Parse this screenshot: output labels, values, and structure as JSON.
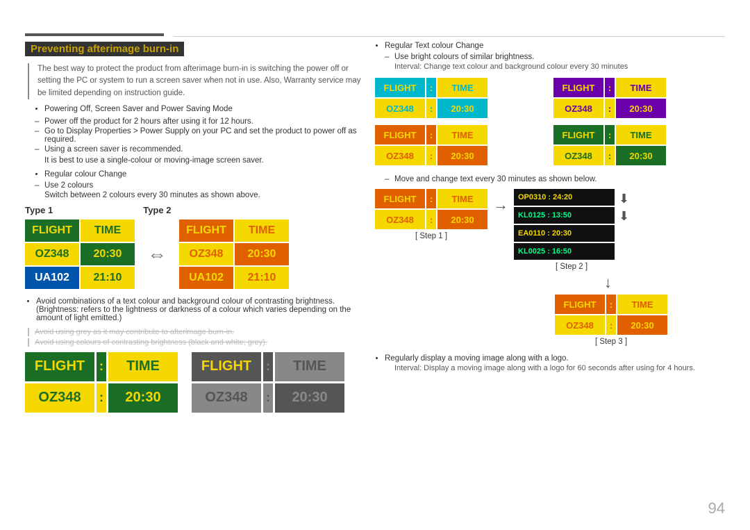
{
  "page": {
    "number": "94",
    "title": "Preventing afterimage burn-in"
  },
  "left": {
    "section_title": "Preventing afterimage burn-in",
    "intro": "The best way to protect the product from afterimage burn-in is switching the power off or setting the PC or system to run a screen saver when not in use. Also, Warranty service may be limited depending on instruction guide.",
    "bullets": [
      "Powering Off, Screen Saver and Power Saving Mode"
    ],
    "sub_bullets_1": [
      "Power off the product for 2 hours after using it for 12 hours.",
      "Go to Display Properties > Power Supply on your PC and set the product to power off as required.",
      "Using a screen saver is recommended."
    ],
    "note_screensaver": "It is best to use a single-colour or moving-image screen saver.",
    "bullets_2": [
      "Regular colour Change"
    ],
    "sub_bullets_2": [
      "Use 2 colours"
    ],
    "switch_note": "Switch between 2 colours every 30 minutes as shown above.",
    "type1_label": "Type 1",
    "type2_label": "Type 2",
    "type1_flight": "FLIGHT",
    "type1_time": "TIME",
    "type1_oz": "OZ348",
    "type1_2030": "20:30",
    "type1_ua": "UA102",
    "type1_2110": "21:10",
    "type2_flight": "FLIGHT",
    "type2_time": "TIME",
    "type2_oz": "OZ348",
    "type2_2030": "20:30",
    "type2_ua": "UA102",
    "type2_2110": "21:10",
    "avoid_bullet": "Avoid combinations of a text colour and background colour of contrasting brightness. (Brightness: refers to the lightness or darkness of a colour which varies depending on the amount of light emitted.)",
    "strikethrough1": "Avoid using grey as it may contribute to afterimage burn-in.",
    "strikethrough2": "Avoid using colours of contrasting brightness (black and white; grey).",
    "bottom_flight1_header": [
      "FLIGHT",
      ":",
      "TIME"
    ],
    "bottom_oz1": "OZ348",
    "bottom_colon1": ":",
    "bottom_2030_1": "20:30",
    "bottom_flight2_header": [
      "FLIGHT",
      ":",
      "TIME"
    ],
    "bottom_oz2": "OZ348",
    "bottom_colon2": ":",
    "bottom_2030_2": "20:30"
  },
  "right": {
    "bullet1": "Regular Text colour Change",
    "sub1": "Use bright colours of similar brightness.",
    "interval1": "Interval: Change text colour and background colour every 30 minutes",
    "grid_displays": [
      {
        "flight": "FLIGHT",
        "colon": ":",
        "time": "TIME",
        "oz": "OZ348",
        "c2": ":",
        "t": "20:30",
        "style": "cyan"
      },
      {
        "flight": "FLIGHT",
        "colon": ":",
        "time": "TIME",
        "oz": "OZ348",
        "c2": ":",
        "t": "20:30",
        "style": "purple"
      },
      {
        "flight": "FLIGHT",
        "colon": ":",
        "time": "TIME",
        "oz": "OZ348",
        "c2": ":",
        "t": "20:30",
        "style": "orange"
      },
      {
        "flight": "FLIGHT",
        "colon": ":",
        "time": "TIME",
        "oz": "OZ348",
        "c2": ":",
        "t": "20:30",
        "style": "green"
      }
    ],
    "move_note": "Move and change text every 30 minutes as shown below.",
    "step1_label": "[ Step 1 ]",
    "step2_label": "[ Step 2 ]",
    "step3_label": "[ Step 3 ]",
    "step1_flight": "FLIGHT",
    "step1_colon": ":",
    "step1_time": "TIME",
    "step1_oz": "OZ348",
    "step1_c2": ":",
    "step1_t": "20:30",
    "step2_rows": [
      "OP0310 : 24:20",
      "KL0125 : 13:50",
      "EA0110 : 20:30",
      "KL0025 : 16:50"
    ],
    "step3_flight": "FLIGHT",
    "step3_colon": ":",
    "step3_time": "TIME",
    "step3_oz": "OZ348",
    "step3_c2": ":",
    "step3_t": "20:30",
    "regularly_bullet": "Regularly display a moving image along with a logo.",
    "interval2": "Interval: Display a moving image along with a logo for 60 seconds after using for 4 hours."
  }
}
